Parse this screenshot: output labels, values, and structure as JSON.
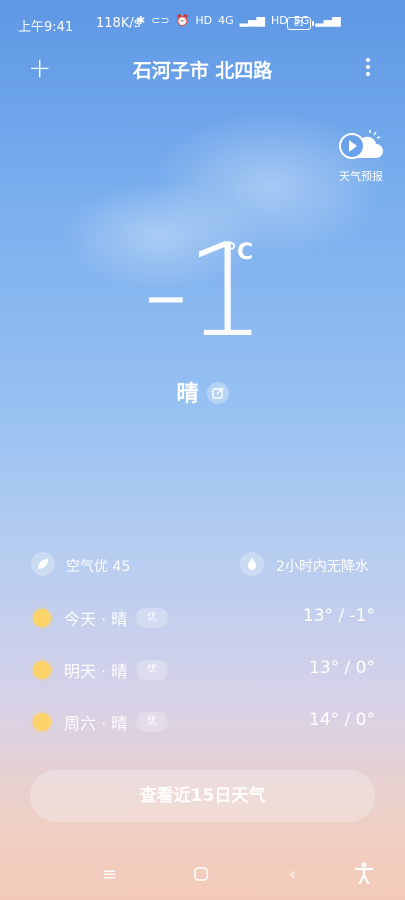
{
  "status": {
    "time": "上午9:41",
    "speed": "118K/s",
    "net1": "4G",
    "net2": "5G",
    "battery": "81"
  },
  "header": {
    "location": "石河子市 北四路"
  },
  "forecast_button": {
    "label": "天气预报"
  },
  "current": {
    "temperature": "-1",
    "unit": "°C",
    "condition": "晴"
  },
  "info": {
    "air_quality": "空气优 45",
    "precipitation": "2小时内无降水"
  },
  "days": [
    {
      "name": "今天 · 晴",
      "aqi": "优",
      "range": "13° / -1°"
    },
    {
      "name": "明天 · 晴",
      "aqi": "优",
      "range": "13° / 0°"
    },
    {
      "name": "周六 · 晴",
      "aqi": "优",
      "range": "14° / 0°"
    }
  ],
  "fifteen_day_label": "查看近15日天气",
  "colors": {
    "sun": "#fdd36a",
    "sky_top": "#5e97e4",
    "sky_bottom": "#f3cab8"
  }
}
